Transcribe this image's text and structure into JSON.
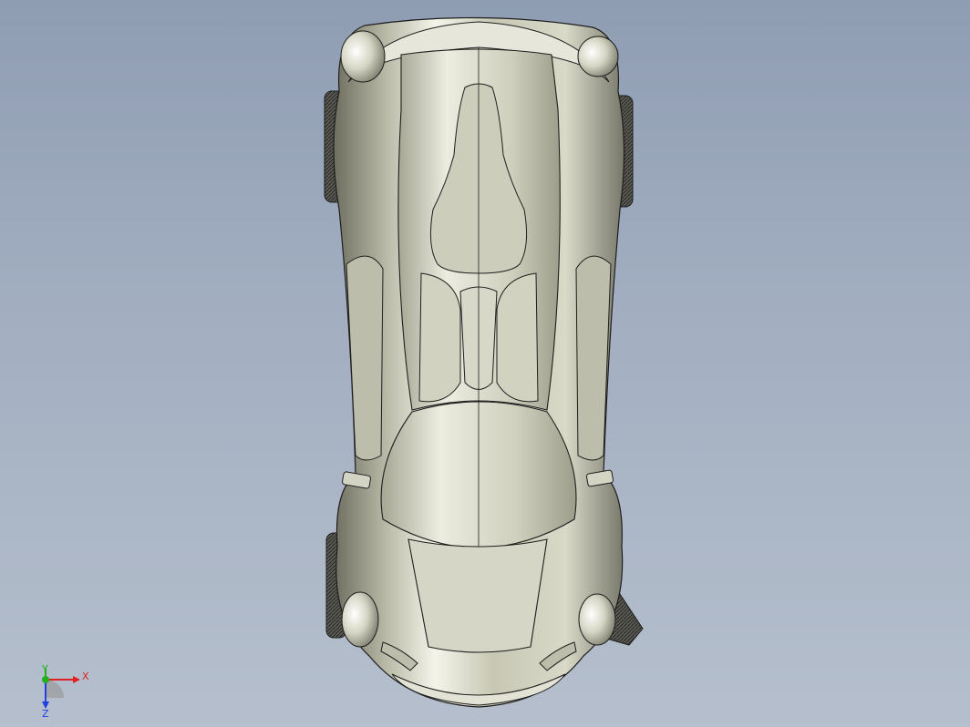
{
  "viewport": {
    "background_top": "#8f9db3",
    "background_bottom": "#b5bfcd",
    "model_color": "#c9c9b8",
    "edge_color": "#1e1e1e"
  },
  "triad": {
    "x_label": "X",
    "y_label": "Y",
    "z_label": "Z",
    "x_color": "#e02020",
    "y_color": "#20b020",
    "z_color": "#2040e0"
  }
}
